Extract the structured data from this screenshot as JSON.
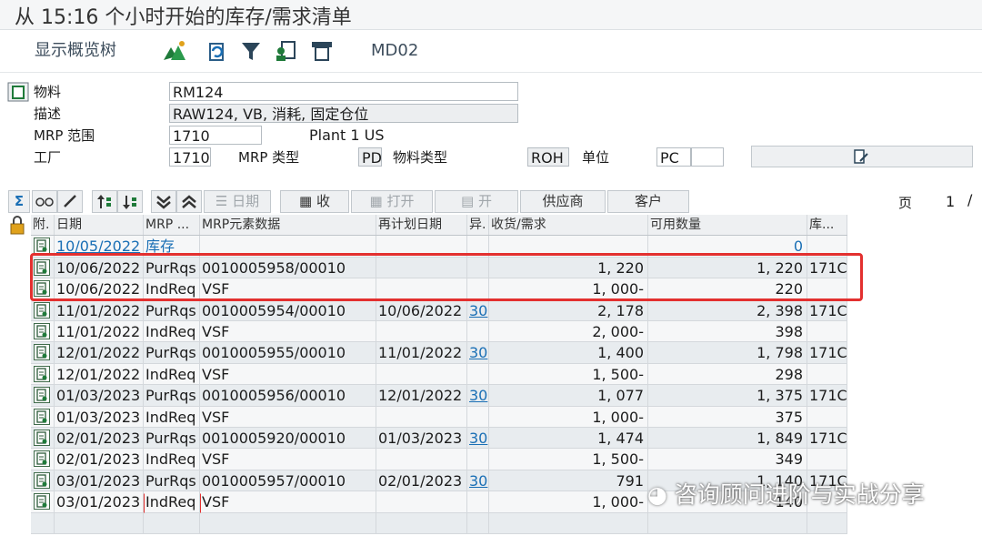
{
  "window": {
    "title": "从 15:16 个小时开始的库存/需求清单"
  },
  "toolbar": {
    "overview_tree_label": "显示概览树",
    "transaction_label": "MD02"
  },
  "header": {
    "material_label": "物料",
    "material_value": "RM124",
    "description_label": "描述",
    "description_value": "RAW124, VB, 消耗, 固定仓位",
    "mrp_area_label": "MRP 范围",
    "mrp_area_value": "1710",
    "mrp_area_name": "Plant 1 US",
    "plant_label": "工厂",
    "plant_value": "1710",
    "mrp_type_label": "MRP 类型",
    "mrp_type_value": "PD",
    "material_type_label": "物料类型",
    "material_type_value": "ROH",
    "unit_label": "单位",
    "unit_value": "PC"
  },
  "tabs": {
    "sum_icon": "Σ",
    "date_label": "日期",
    "receive_label": "收",
    "open_label": "打开",
    "open2_label": "开",
    "supplier_label": "供应商",
    "customer_label": "客户",
    "page_label": "页",
    "page_num": "1",
    "page_slash": "/"
  },
  "grid": {
    "headers": [
      "附.",
      "日期",
      "MRP ...",
      "MRP元素数据",
      "再计划日期",
      "异.",
      "收货/需求",
      "可用数量",
      "库..."
    ],
    "rows": [
      {
        "date": "10/05/2022",
        "mrp": "库存",
        "data": "",
        "resched": "",
        "exc": "",
        "qty": "",
        "avail": "0",
        "stor": ""
      },
      {
        "date": "10/06/2022",
        "mrp": "PurRqs",
        "data": "0010005958/00010",
        "resched": "",
        "exc": "",
        "qty": "1, 220",
        "avail": "1, 220",
        "stor": "171C"
      },
      {
        "date": "10/06/2022",
        "mrp": "IndReq",
        "data": "VSF",
        "resched": "",
        "exc": "",
        "qty": "1, 000-",
        "avail": "220",
        "stor": ""
      },
      {
        "date": "11/01/2022",
        "mrp": "PurRqs",
        "data": "0010005954/00010",
        "resched": "10/06/2022",
        "exc": "30",
        "qty": "2, 178",
        "avail": "2, 398",
        "stor": "171C"
      },
      {
        "date": "11/01/2022",
        "mrp": "IndReq",
        "data": "VSF",
        "resched": "",
        "exc": "",
        "qty": "2, 000-",
        "avail": "398",
        "stor": ""
      },
      {
        "date": "12/01/2022",
        "mrp": "PurRqs",
        "data": "0010005955/00010",
        "resched": "11/01/2022",
        "exc": "30",
        "qty": "1, 400",
        "avail": "1, 798",
        "stor": "171C"
      },
      {
        "date": "12/01/2022",
        "mrp": "IndReq",
        "data": "VSF",
        "resched": "",
        "exc": "",
        "qty": "1, 500-",
        "avail": "298",
        "stor": ""
      },
      {
        "date": "01/03/2023",
        "mrp": "PurRqs",
        "data": "0010005956/00010",
        "resched": "12/01/2022",
        "exc": "30",
        "qty": "1, 077",
        "avail": "1, 375",
        "stor": "171C"
      },
      {
        "date": "01/03/2023",
        "mrp": "IndReq",
        "data": "VSF",
        "resched": "",
        "exc": "",
        "qty": "1, 000-",
        "avail": "375",
        "stor": ""
      },
      {
        "date": "02/01/2023",
        "mrp": "PurRqs",
        "data": "0010005920/00010",
        "resched": "01/03/2023",
        "exc": "30",
        "qty": "1, 474",
        "avail": "1, 849",
        "stor": "171C"
      },
      {
        "date": "02/01/2023",
        "mrp": "IndReq",
        "data": "VSF",
        "resched": "",
        "exc": "",
        "qty": "1, 500-",
        "avail": "349",
        "stor": ""
      },
      {
        "date": "03/01/2023",
        "mrp": "PurRqs",
        "data": "0010005957/00010",
        "resched": "02/01/2023",
        "exc": "30",
        "qty": "791",
        "avail": "1, 140",
        "stor": "171C"
      },
      {
        "date": "03/01/2023",
        "mrp": "IndReq",
        "data": "VSF",
        "resched": "",
        "exc": "",
        "qty": "1, 000-",
        "avail": "140",
        "stor": ""
      }
    ]
  },
  "watermark": {
    "text": "咨询顾问进阶与实战分享"
  },
  "icons": {
    "toolbar": [
      "tree-icon",
      "refresh-icon",
      "filter-icon",
      "user-plan-icon",
      "print-icon",
      "edit-note-icon"
    ],
    "row": "document-icon"
  }
}
